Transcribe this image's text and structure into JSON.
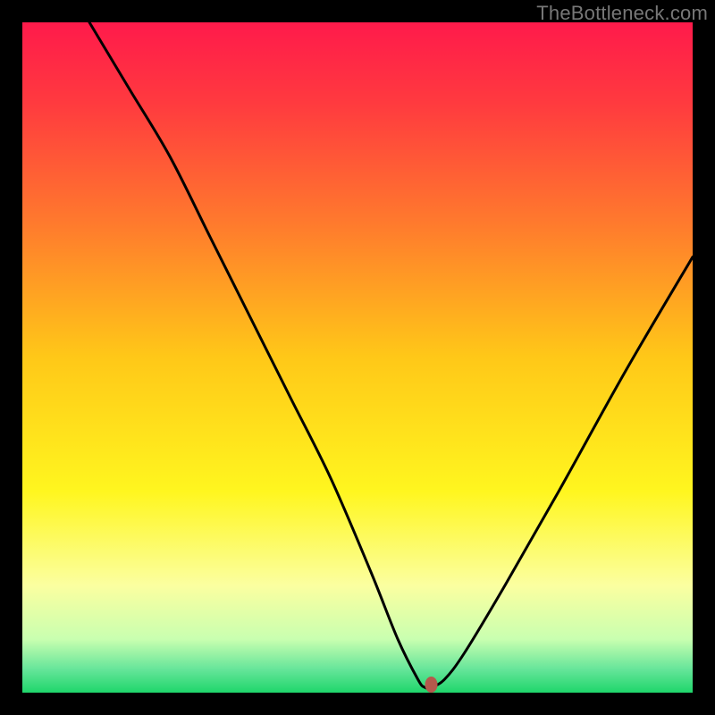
{
  "watermark": "TheBottleneck.com",
  "chart_data": {
    "type": "line",
    "title": "",
    "xlabel": "",
    "ylabel": "",
    "xlim": [
      0,
      100
    ],
    "ylim": [
      0,
      100
    ],
    "grid": false,
    "legend": false,
    "background_gradient": {
      "stops": [
        {
          "offset": 0.0,
          "color": "#ff1a4b"
        },
        {
          "offset": 0.12,
          "color": "#ff3a3f"
        },
        {
          "offset": 0.3,
          "color": "#ff7a2d"
        },
        {
          "offset": 0.5,
          "color": "#ffc818"
        },
        {
          "offset": 0.7,
          "color": "#fff61f"
        },
        {
          "offset": 0.84,
          "color": "#fbffa0"
        },
        {
          "offset": 0.92,
          "color": "#c9ffb0"
        },
        {
          "offset": 0.965,
          "color": "#66e59a"
        },
        {
          "offset": 1.0,
          "color": "#1fd66b"
        }
      ]
    },
    "series": [
      {
        "name": "bottleneck-curve",
        "x": [
          10,
          16,
          22,
          28,
          34,
          40,
          46,
          52,
          56,
          59,
          60,
          61,
          63,
          66,
          72,
          80,
          90,
          100
        ],
        "y": [
          100,
          90,
          80,
          68,
          56,
          44,
          32,
          18,
          8,
          2,
          0.8,
          0.8,
          2,
          6,
          16,
          30,
          48,
          65
        ]
      }
    ],
    "marker": {
      "name": "optimal-point",
      "x": 61,
      "y": 1.2,
      "color": "#b5594c"
    }
  }
}
